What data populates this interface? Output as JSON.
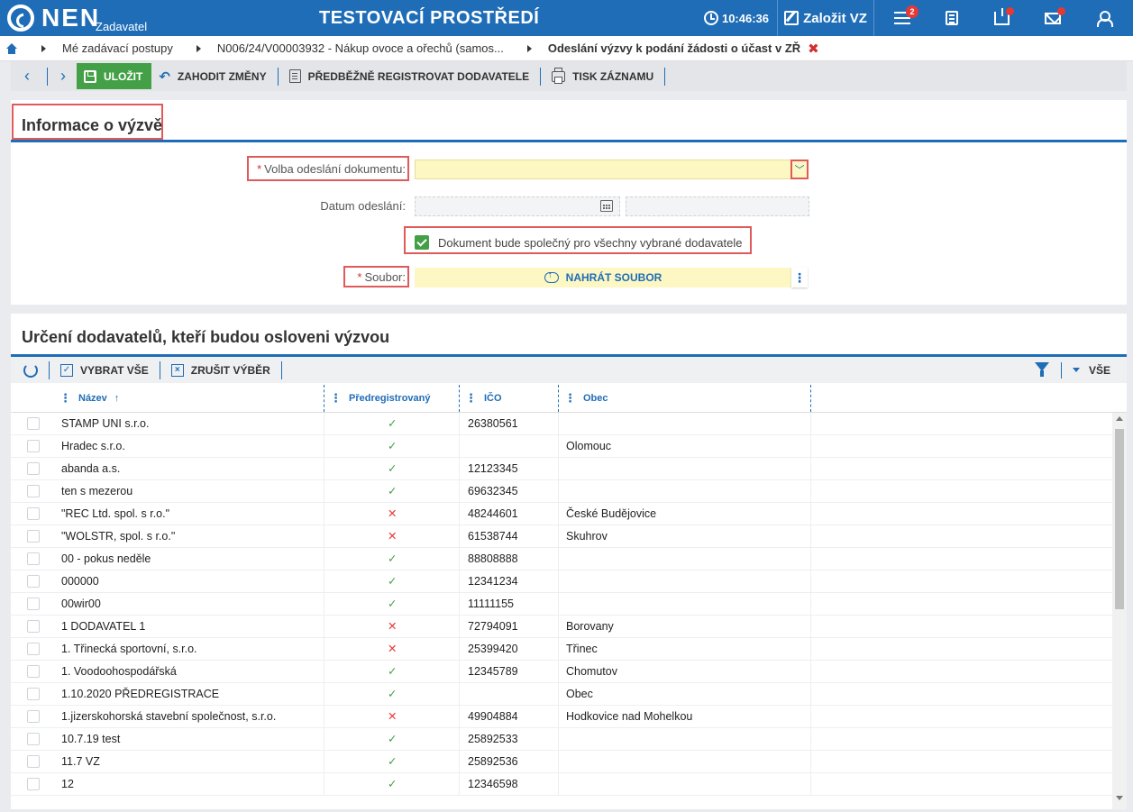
{
  "header": {
    "logo": "NEN",
    "logo_sub": "Zadavatel",
    "env_title": "TESTOVACÍ PROSTŘEDÍ",
    "time": "10:46:36",
    "create_label": "Založit VZ",
    "menu_badge": "2",
    "accent_color": "#1f6db7"
  },
  "breadcrumb": {
    "items": [
      "Mé zadávací postupy",
      "N006/24/V00003932 - Nákup ovoce a ořechů (samos...",
      "Odeslání výzvy k podání žádosti o účast v ZŘ"
    ],
    "close_glyph": "✖"
  },
  "toolbar": {
    "back_glyph": "‹",
    "forward_glyph": "›",
    "save_label": "ULOŽIT",
    "discard_label": "ZAHODIT ZMĚNY",
    "preregister_label": "PŘEDBĚŽNĚ REGISTROVAT DODAVATELE",
    "print_label": "TISK ZÁZNAMU"
  },
  "info": {
    "title": "Informace o výzvě",
    "send_choice_label": "Volba odeslání dokumentu:",
    "send_choice_value": "",
    "date_label": "Datum odeslání:",
    "date_value": "",
    "common_doc_label": "Dokument bude společný pro všechny vybrané dodavatele",
    "common_doc_checked": true,
    "file_label": "Soubor:",
    "upload_label": "NAHRÁT SOUBOR",
    "required_mark": "*"
  },
  "suppliers": {
    "title": "Určení dodavatelů, kteří budou osloveni výzvou",
    "select_all_label": "VYBRAT VŠE",
    "clear_selection_label": "ZRUŠIT VÝBĚR",
    "filter_label": "VŠE",
    "columns": [
      "Název",
      "Předregistrovaný",
      "IČO",
      "Obec"
    ],
    "sort_glyph": "↑",
    "ok_glyph": "✓",
    "no_glyph": "✕",
    "rows": [
      {
        "name": "STAMP UNI s.r.o.",
        "prereg": true,
        "ico": "26380561",
        "city": ""
      },
      {
        "name": "Hradec s.r.o.",
        "prereg": true,
        "ico": "",
        "city": "Olomouc"
      },
      {
        "name": "abanda a.s.",
        "prereg": true,
        "ico": "12123345",
        "city": ""
      },
      {
        "name": "ten s mezerou",
        "prereg": true,
        "ico": "69632345",
        "city": ""
      },
      {
        "name": "\"REC Ltd. spol. s r.o.\"",
        "prereg": false,
        "ico": "48244601",
        "city": "České Budějovice"
      },
      {
        "name": "\"WOLSTR, spol. s r.o.\"",
        "prereg": false,
        "ico": "61538744",
        "city": "Skuhrov"
      },
      {
        "name": "00 - pokus neděle",
        "prereg": true,
        "ico": "88808888",
        "city": ""
      },
      {
        "name": "000000",
        "prereg": true,
        "ico": "12341234",
        "city": ""
      },
      {
        "name": "00wir00",
        "prereg": true,
        "ico": "11111155",
        "city": ""
      },
      {
        "name": "1 DODAVATEL 1",
        "prereg": false,
        "ico": "72794091",
        "city": "Borovany"
      },
      {
        "name": "1. Třinecká sportovní, s.r.o.",
        "prereg": false,
        "ico": "25399420",
        "city": "Třinec"
      },
      {
        "name": "1. Voodoohospodářská",
        "prereg": true,
        "ico": "12345789",
        "city": "Chomutov"
      },
      {
        "name": "1.10.2020 PŘEDREGISTRACE",
        "prereg": true,
        "ico": "",
        "city": "Obec"
      },
      {
        "name": "1.jizerskohorská stavební společnost, s.r.o.",
        "prereg": false,
        "ico": "49904884",
        "city": "Hodkovice nad Mohelkou"
      },
      {
        "name": "10.7.19 test",
        "prereg": true,
        "ico": "25892533",
        "city": ""
      },
      {
        "name": "11.7 VZ",
        "prereg": true,
        "ico": "25892536",
        "city": ""
      },
      {
        "name": "12",
        "prereg": true,
        "ico": "12346598",
        "city": ""
      }
    ]
  }
}
